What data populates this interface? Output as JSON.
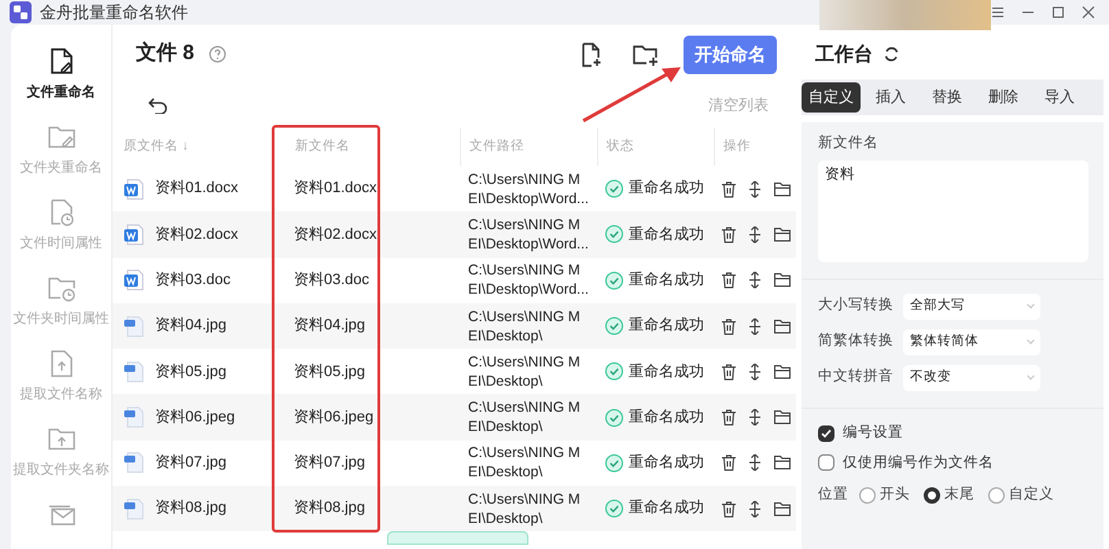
{
  "window": {
    "title": "金舟批量重命名软件"
  },
  "sidebar": {
    "items": [
      {
        "label": "文件重命名",
        "selected": true
      },
      {
        "label": "文件夹重命名",
        "selected": false
      },
      {
        "label": "文件时间属性",
        "selected": false
      },
      {
        "label": "文件夹时间属性",
        "selected": false
      },
      {
        "label": "提取文件名称",
        "selected": false
      },
      {
        "label": "提取文件夹名称",
        "selected": false
      },
      {
        "selected": false
      }
    ]
  },
  "file_list": {
    "title": "文件 8",
    "start_button": "开始命名",
    "clear_link": "清空列表",
    "columns": [
      "原文件名 ↓",
      "新文件名",
      "文件路径",
      "状态",
      "操作"
    ],
    "rows": [
      {
        "kind": "word",
        "original": "资料01.docx",
        "new": "资料01.docx",
        "path": [
          "C:\\Users\\NING M",
          "EI\\Desktop\\Word..."
        ],
        "status": "重命名成功"
      },
      {
        "kind": "word",
        "original": "资料02.docx",
        "new": "资料02.docx",
        "path": [
          "C:\\Users\\NING M",
          "EI\\Desktop\\Word..."
        ],
        "status": "重命名成功"
      },
      {
        "kind": "word",
        "original": "资料03.doc",
        "new": "资料03.doc",
        "path": [
          "C:\\Users\\NING M",
          "EI\\Desktop\\Word..."
        ],
        "status": "重命名成功"
      },
      {
        "kind": "image",
        "original": "资料04.jpg",
        "new": "资料04.jpg",
        "path": [
          "C:\\Users\\NING M",
          "EI\\Desktop\\"
        ],
        "status": "重命名成功"
      },
      {
        "kind": "image",
        "original": "资料05.jpg",
        "new": "资料05.jpg",
        "path": [
          "C:\\Users\\NING M",
          "EI\\Desktop\\"
        ],
        "status": "重命名成功"
      },
      {
        "kind": "image",
        "original": "资料06.jpeg",
        "new": "资料06.jpeg",
        "path": [
          "C:\\Users\\NING M",
          "EI\\Desktop\\"
        ],
        "status": "重命名成功"
      },
      {
        "kind": "image",
        "original": "资料07.jpg",
        "new": "资料07.jpg",
        "path": [
          "C:\\Users\\NING M",
          "EI\\Desktop\\"
        ],
        "status": "重命名成功"
      },
      {
        "kind": "image",
        "original": "资料08.jpg",
        "new": "资料08.jpg",
        "path": [
          "C:\\Users\\NING M",
          "EI\\Desktop\\"
        ],
        "status": "重命名成功"
      }
    ]
  },
  "workbench": {
    "title": "工作台",
    "tabs": [
      {
        "label": "自定义",
        "selected": true
      },
      {
        "label": "插入",
        "selected": false
      },
      {
        "label": "替换",
        "selected": false
      },
      {
        "label": "删除",
        "selected": false
      },
      {
        "label": "导入",
        "selected": false
      }
    ],
    "new_name": {
      "label": "新文件名",
      "value": "资料"
    },
    "selects": [
      {
        "label": "大小写转换",
        "value": "全部大写"
      },
      {
        "label": "简繁体转换",
        "value": "繁体转简体"
      },
      {
        "label": "中文转拼音",
        "value": "不改变"
      }
    ],
    "checkboxes": [
      {
        "label": "编号设置",
        "checked": true
      },
      {
        "label": "仅使用编号作为文件名",
        "checked": false
      }
    ],
    "position": {
      "label": "位置",
      "options": [
        {
          "label": "开头",
          "selected": false
        },
        {
          "label": "末尾",
          "selected": true
        },
        {
          "label": "自定义",
          "selected": false
        }
      ]
    }
  }
}
